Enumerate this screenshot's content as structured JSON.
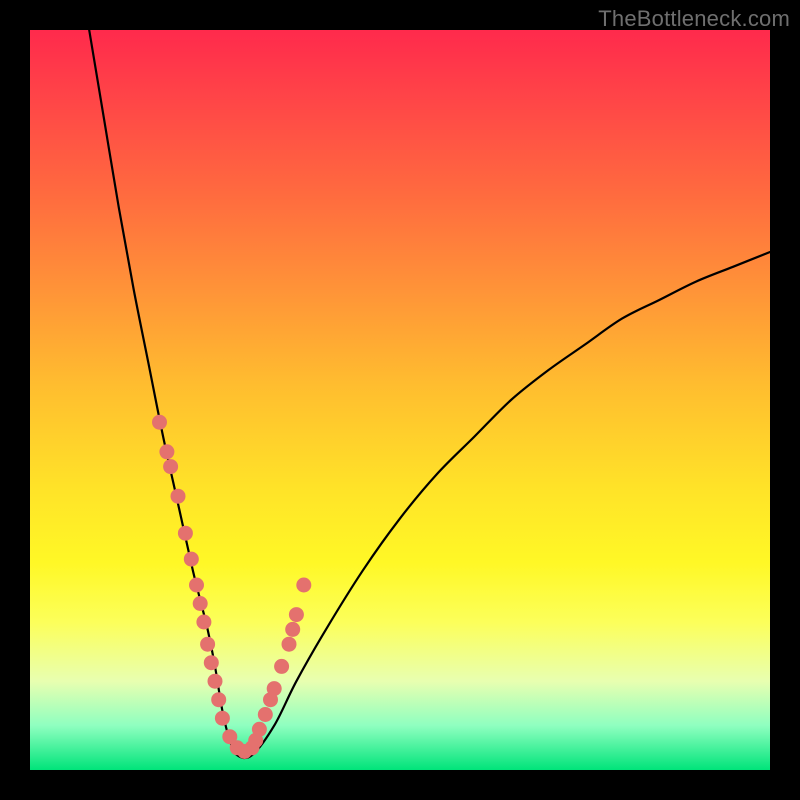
{
  "watermark": "TheBottleneck.com",
  "colors": {
    "page_bg": "#000000",
    "gradient_top": "#ff2a4c",
    "gradient_bottom": "#00e47a",
    "curve": "#000000",
    "dots": "#e4716e"
  },
  "chart_data": {
    "type": "line",
    "title": "",
    "xlabel": "",
    "ylabel": "",
    "xlim": [
      0,
      100
    ],
    "ylim": [
      0,
      100
    ],
    "grid": false,
    "legend": false,
    "series": [
      {
        "name": "curve",
        "x": [
          8,
          10,
          12,
          14,
          16,
          18,
          20,
          22,
          23,
          24,
          25,
          26,
          27,
          28,
          30,
          33,
          36,
          40,
          45,
          50,
          55,
          60,
          65,
          70,
          75,
          80,
          85,
          90,
          95,
          100
        ],
        "y": [
          100,
          88,
          76,
          65,
          55,
          45,
          36,
          27,
          23,
          19,
          14,
          8,
          4,
          2,
          2,
          6,
          12,
          19,
          27,
          34,
          40,
          45,
          50,
          54,
          57.5,
          61,
          63.5,
          66,
          68,
          70
        ]
      }
    ],
    "dots": {
      "name": "highlighted-points",
      "x": [
        17.5,
        18.5,
        19,
        20,
        21,
        21.8,
        22.5,
        23,
        23.5,
        24,
        24.5,
        25,
        25.5,
        26,
        27,
        28,
        29,
        30,
        30.5,
        31,
        31.8,
        32.5,
        33,
        34,
        35,
        35.5,
        36,
        37
      ],
      "y": [
        47,
        43,
        41,
        37,
        32,
        28.5,
        25,
        22.5,
        20,
        17,
        14.5,
        12,
        9.5,
        7,
        4.5,
        3,
        2.5,
        3,
        4,
        5.5,
        7.5,
        9.5,
        11,
        14,
        17,
        19,
        21,
        25
      ]
    }
  }
}
